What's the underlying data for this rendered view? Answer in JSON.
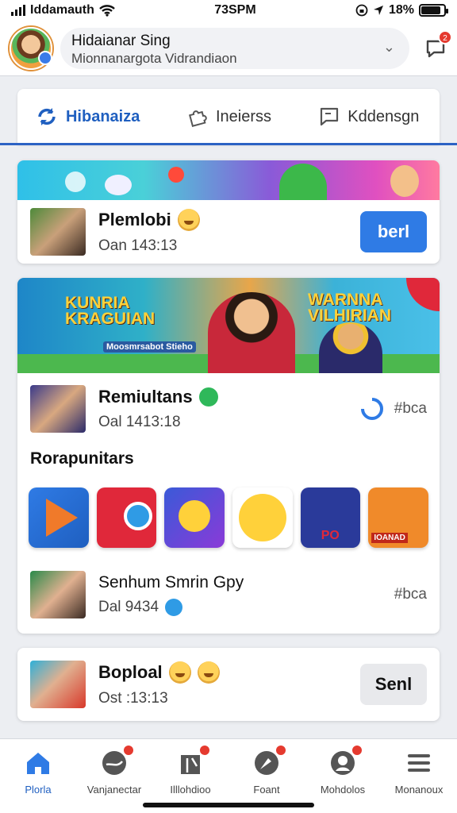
{
  "status": {
    "carrier": "Iddamauth",
    "time": "73SPM",
    "battery": "18%",
    "battery_level": 0.85
  },
  "header": {
    "name": "Hidaianar Sing",
    "subtitle": "Mionnanargota Vidrandiaon",
    "notif_count": "2"
  },
  "tabs": [
    {
      "label": "Hibanaiza",
      "icon": "refresh-icon"
    },
    {
      "label": "Ineierss",
      "icon": "puzzle-icon"
    },
    {
      "label": "Kddensgn",
      "icon": "chat-square-icon"
    }
  ],
  "post1": {
    "title": "Plemlobi",
    "time": "Oan 143:13",
    "action": "berl"
  },
  "post2": {
    "banner_left_title": "KUNRIA KRAGUIAN",
    "banner_left_sub": "Moosmrsabot Stieho",
    "banner_right_title": "WARNNA VILHIRIAN",
    "title": "Remiultans",
    "time": "Oal 1413:18",
    "tag": "#bca",
    "section_title": "Rorapunitars",
    "item_title": "Senhum Smrin Gpy",
    "item_time": "Dal 9434",
    "item_tag": "#bca",
    "apps": [
      "video-app-icon",
      "star-app-icon",
      "smile-app-icon",
      "bear-emoji-icon",
      "couple-app-icon",
      "laugh-emoji-icon"
    ],
    "app_label_5": "PO",
    "app_label_6": "IOANAD"
  },
  "post3": {
    "title": "Boploal",
    "time": "Ost :13:13",
    "action": "Senl"
  },
  "bottom_nav": [
    {
      "label": "Plorla",
      "icon": "home-icon"
    },
    {
      "label": "Vanjanectar",
      "icon": "globe-icon"
    },
    {
      "label": "Illlohdioo",
      "icon": "gift-icon"
    },
    {
      "label": "Foant",
      "icon": "compass-icon"
    },
    {
      "label": "Mohdolos",
      "icon": "face-icon"
    },
    {
      "label": "Monanoux",
      "icon": "menu-icon"
    }
  ],
  "colors": {
    "accent": "#2f7be5",
    "accent_dark": "#1f5fc0",
    "badge": "#e53a2f"
  }
}
